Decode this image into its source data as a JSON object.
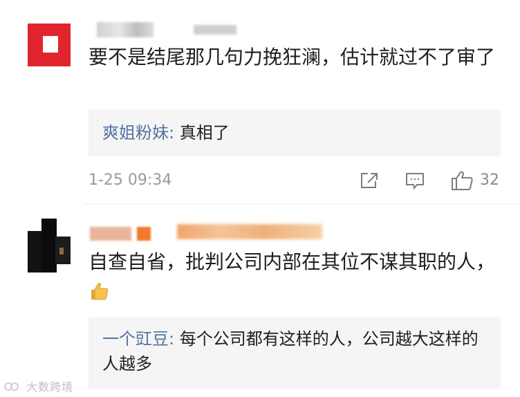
{
  "comments": [
    {
      "text": "要不是结尾那几句力挽狂澜，估计就过不了审了",
      "reply": {
        "name": "爽姐粉妹:",
        "text": " 真相了"
      },
      "timestamp": "1-25 09:34",
      "likes": "32"
    },
    {
      "text": "自查自省，批判公司内部在其位不谋其职的人，",
      "emoji": "thumbs-up-emoji",
      "reply": {
        "name": "一个豇豆:",
        "text": " 每个公司都有这样的人，公司越大这样的人越多"
      }
    }
  ],
  "icons": {
    "share": "share-icon",
    "comment": "comment-icon",
    "like": "like-icon"
  },
  "watermark": "大数跨境",
  "colors": {
    "reply_name": "#52739f",
    "reply_bg": "#f5f5f5",
    "meta_text": "#9a9a9a"
  }
}
